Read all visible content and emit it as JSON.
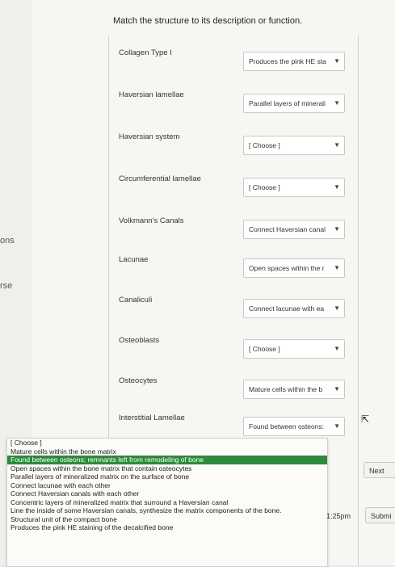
{
  "sidebar": {
    "fragments": [
      "ons",
      "rse"
    ]
  },
  "question": {
    "prompt": "Match the structure to its description or function."
  },
  "rows": [
    {
      "term": "Collagen Type I",
      "selected": "Produces the pink HE sta"
    },
    {
      "term": "Haversian lamellae",
      "selected": "Parallel layers of minerali"
    },
    {
      "term": "Haversian system",
      "selected": "[ Choose ]"
    },
    {
      "term": "Circumferential lamellae",
      "selected": "[ Choose ]"
    },
    {
      "term": "Volkmann's Canals",
      "selected": "Connect Haversian canal"
    },
    {
      "term": "Lacunae",
      "selected": "Open spaces within the r"
    },
    {
      "term": "Canaliculi",
      "selected": "Connect lacunae with ea"
    },
    {
      "term": "Osteoblasts",
      "selected": "[ Choose ]"
    },
    {
      "term": "Osteocytes",
      "selected": "Mature cells within the b"
    },
    {
      "term": "Interstitial Lamellae",
      "selected": "Found between osteons:"
    }
  ],
  "dropdown": {
    "options": [
      "[ Choose ]",
      "Mature cells within the bone matrix",
      "Found between osteons; remnants left from remodeling of bone",
      "Open spaces within the bone matrix that contain osteocytes",
      "Parallel layers of mineralized matrix on the surface of bone",
      "Connect lacunae with each other",
      "Connect Haversian canals with each other",
      "Concentric layers of mineralized matrix that surround a Haversian canal",
      "Line the inside of some Haversian canals, synthesize the matrix components of the bone.",
      "Structural unit of the compact bone",
      "Produces the pink HE staining of the decalcified bone"
    ],
    "highlighted_index": 2,
    "highlight_color": "#2c8a3a"
  },
  "footer": {
    "next_label": "Next",
    "time": "1:25pm",
    "submit_label": "Submi"
  }
}
